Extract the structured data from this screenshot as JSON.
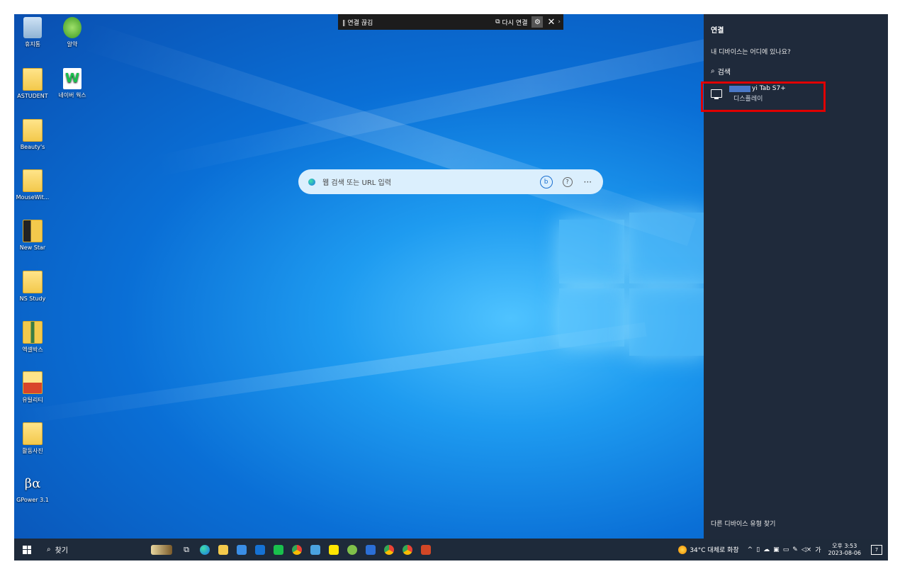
{
  "remote_bar": {
    "disconnect_label": "‖ 연결 끊김",
    "reconnect_label": "다시 연결",
    "close_glyph": "✕"
  },
  "desktop_icons": [
    {
      "label": "휴지통",
      "icon": "recycle-bin-icon"
    },
    {
      "label": "알약",
      "icon": "alyac-icon"
    },
    {
      "label": "ASTUDENT",
      "icon": "folder-icon"
    },
    {
      "label": "네이버 웍스",
      "icon": "naver-works-icon"
    },
    {
      "label": "Beauty's",
      "icon": "folder-icon"
    },
    {
      "label": "MouseWit...",
      "icon": "folder-icon"
    },
    {
      "label": "New Star",
      "icon": "folder-icon"
    },
    {
      "label": "NS Study",
      "icon": "folder-icon"
    },
    {
      "label": "엑셀박스",
      "icon": "folder-icon"
    },
    {
      "label": "유틸리티",
      "icon": "folder-icon"
    },
    {
      "label": "활동사진",
      "icon": "folder-icon"
    },
    {
      "label": "GPower 3.1",
      "icon": "gpower-icon"
    }
  ],
  "browser_search": {
    "placeholder": "웹 검색 또는 URL 입력",
    "bing_glyph": "b",
    "help_glyph": "?",
    "more_glyph": "···"
  },
  "connect_panel": {
    "title": "연결",
    "question": "내 디바이스는 어디에 있나요?",
    "search_label": "검색",
    "device_name_visible": "yi Tab S7+",
    "device_type": "디스플레이",
    "other_devices_link": "다른 디바이스 유형 찾기"
  },
  "taskbar": {
    "search_label": "찾기",
    "weather_text": "34°C 대체로 화창",
    "lang_indicator": "가",
    "time": "오후 3:53",
    "date": "2023-08-06",
    "notification_count": "7"
  },
  "colors": {
    "panel_bg": "#1f2a3b",
    "taskbar_bg": "#1e2a3a",
    "highlight": "#e00000"
  }
}
